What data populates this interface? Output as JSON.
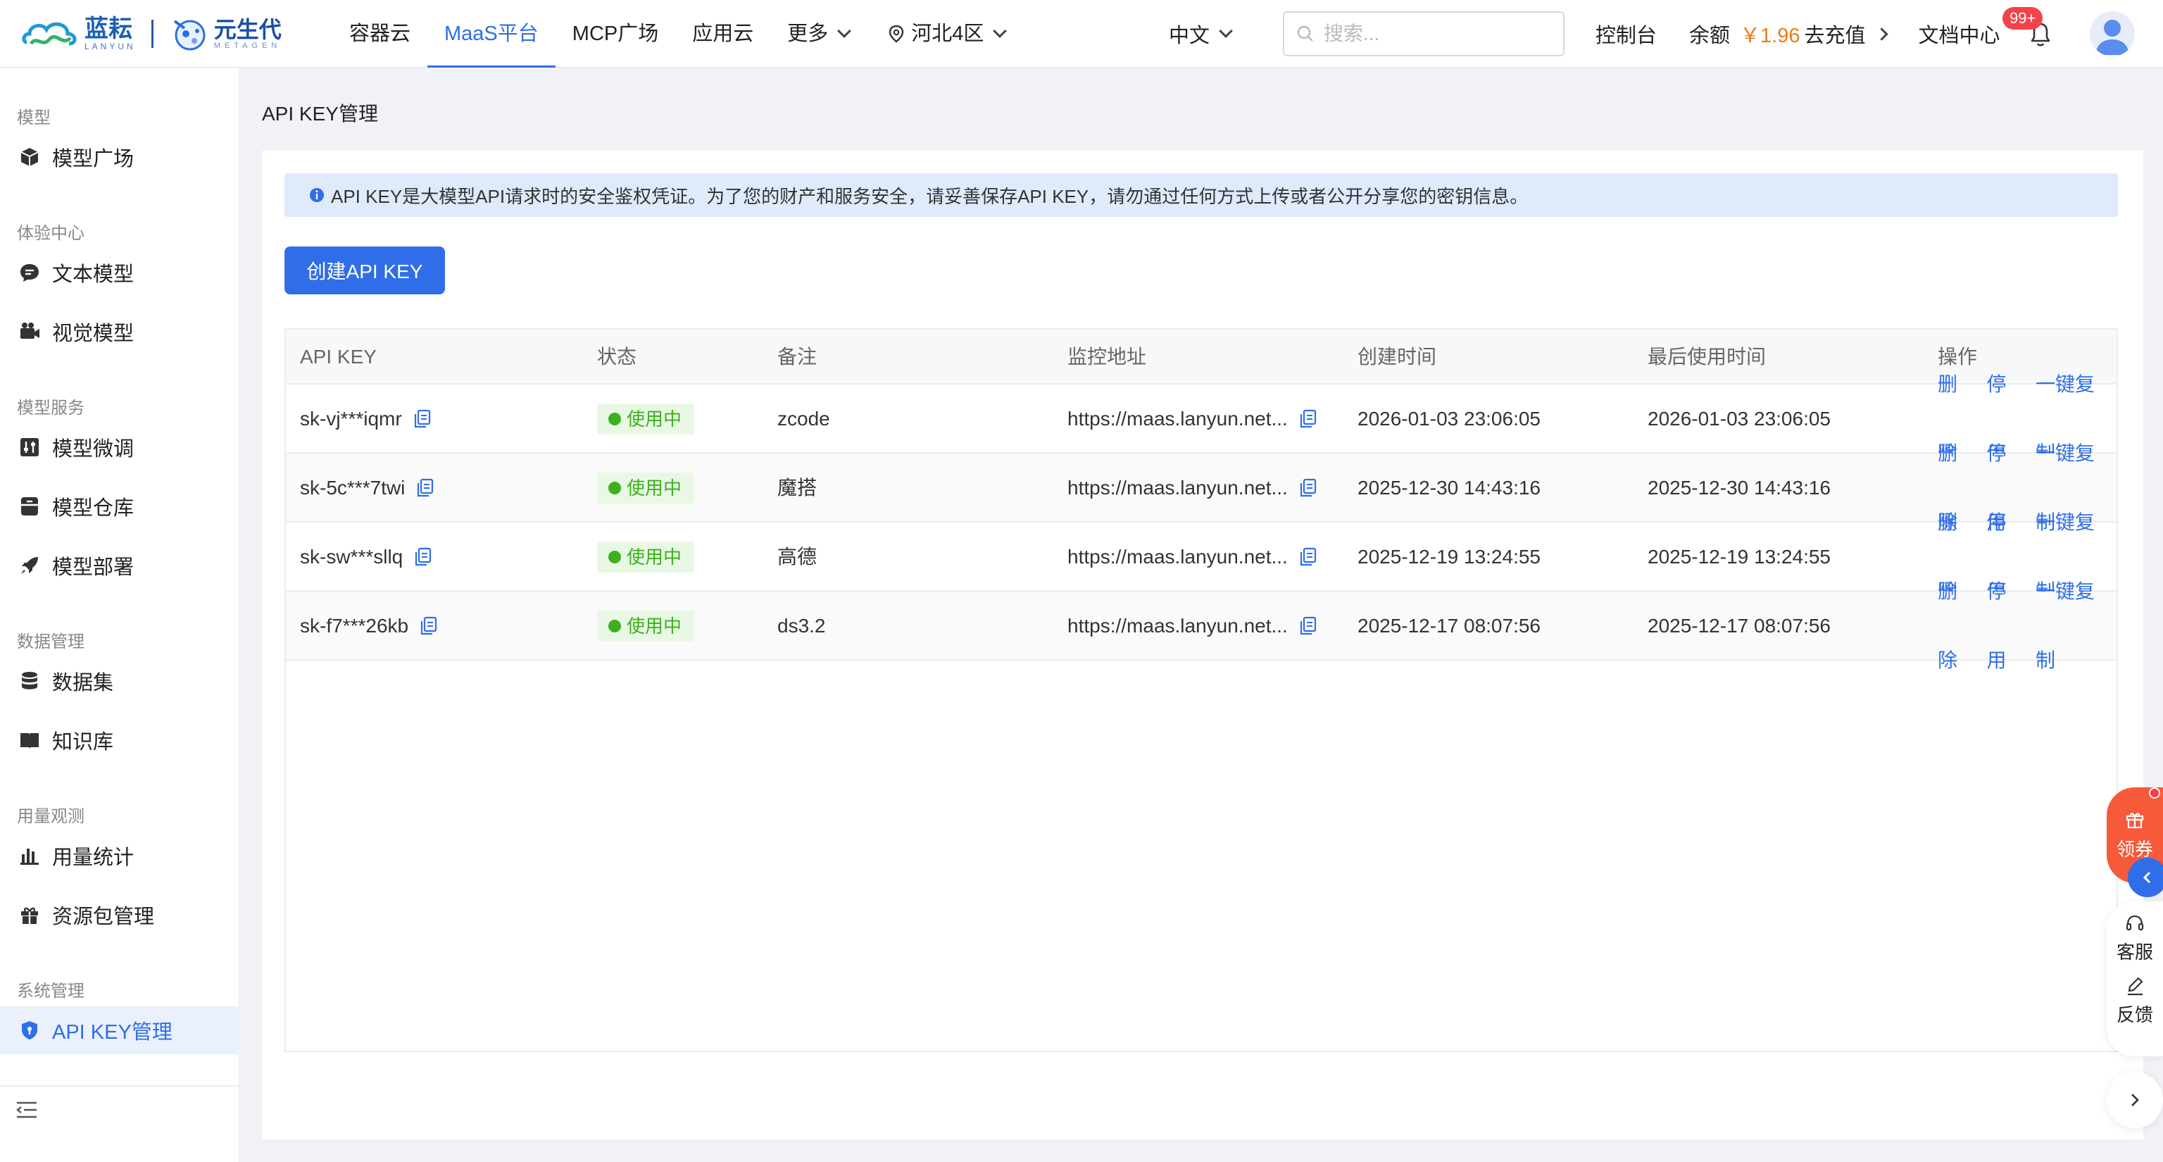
{
  "brand": {
    "logo1_text": "蓝耘",
    "logo1_sub": "LANYUN",
    "logo2_text": "元生代",
    "logo2_sub": "METAGEN"
  },
  "nav": {
    "items": [
      {
        "label": "容器云",
        "active": false
      },
      {
        "label": "MaaS平台",
        "active": true
      },
      {
        "label": "MCP广场",
        "active": false
      },
      {
        "label": "应用云",
        "active": false
      },
      {
        "label": "更多",
        "active": false
      }
    ],
    "region": "河北4区",
    "language": "中文",
    "search_placeholder": "搜索...",
    "console": "控制台",
    "balance_label": "余额",
    "balance_amount": "￥1.96",
    "recharge": "去充值",
    "docs": "文档中心",
    "notification_badge": "99+"
  },
  "sidebar": {
    "groups": [
      {
        "title": "模型",
        "items": [
          {
            "label": "模型广场",
            "icon": "cube-icon"
          }
        ]
      },
      {
        "title": "体验中心",
        "items": [
          {
            "label": "文本模型",
            "icon": "chat-icon"
          },
          {
            "label": "视觉模型",
            "icon": "camera-icon"
          }
        ]
      },
      {
        "title": "模型服务",
        "items": [
          {
            "label": "模型微调",
            "icon": "tune-icon"
          },
          {
            "label": "模型仓库",
            "icon": "archive-icon"
          },
          {
            "label": "模型部署",
            "icon": "rocket-icon"
          }
        ]
      },
      {
        "title": "数据管理",
        "items": [
          {
            "label": "数据集",
            "icon": "database-icon"
          },
          {
            "label": "知识库",
            "icon": "book-icon"
          }
        ]
      },
      {
        "title": "用量观测",
        "items": [
          {
            "label": "用量统计",
            "icon": "bar-chart-icon"
          },
          {
            "label": "资源包管理",
            "icon": "gift-icon"
          }
        ]
      },
      {
        "title": "系统管理",
        "items": [
          {
            "label": "API KEY管理",
            "icon": "shield-icon",
            "active": true
          }
        ]
      }
    ]
  },
  "main": {
    "title": "API KEY管理",
    "notice": "API KEY是大模型API请求时的安全鉴权凭证。为了您的财产和服务安全，请妥善保存API KEY，请勿通过任何方式上传或者公开分享您的密钥信息。",
    "create_button": "创建API KEY",
    "table": {
      "columns": [
        "API KEY",
        "状态",
        "备注",
        "监控地址",
        "创建时间",
        "最后使用时间",
        "操作"
      ],
      "rows": [
        {
          "key": "sk-vj***iqmr",
          "status": "使用中",
          "remark": "zcode",
          "url": "https://maas.lanyun.net...",
          "created": "2026-01-03 23:06:05",
          "last_used": "2026-01-03 23:06:05"
        },
        {
          "key": "sk-5c***7twi",
          "status": "使用中",
          "remark": "魔搭",
          "url": "https://maas.lanyun.net...",
          "created": "2025-12-30 14:43:16",
          "last_used": "2025-12-30 14:43:16"
        },
        {
          "key": "sk-sw***sllq",
          "status": "使用中",
          "remark": "高德",
          "url": "https://maas.lanyun.net...",
          "created": "2025-12-19 13:24:55",
          "last_used": "2025-12-19 13:24:55"
        },
        {
          "key": "sk-f7***26kb",
          "status": "使用中",
          "remark": "ds3.2",
          "url": "https://maas.lanyun.net...",
          "created": "2025-12-17 08:07:56",
          "last_used": "2025-12-17 08:07:56"
        }
      ],
      "actions": [
        "删除",
        "停用",
        "一键复制"
      ]
    }
  },
  "floating": {
    "coupon": "领券",
    "service": "客服",
    "feedback": "反馈"
  },
  "colors": {
    "accent": "#2f6ee8",
    "status_green": "#3cb01e",
    "balance_orange": "#f07b13",
    "coupon_red": "#f65a3a"
  }
}
